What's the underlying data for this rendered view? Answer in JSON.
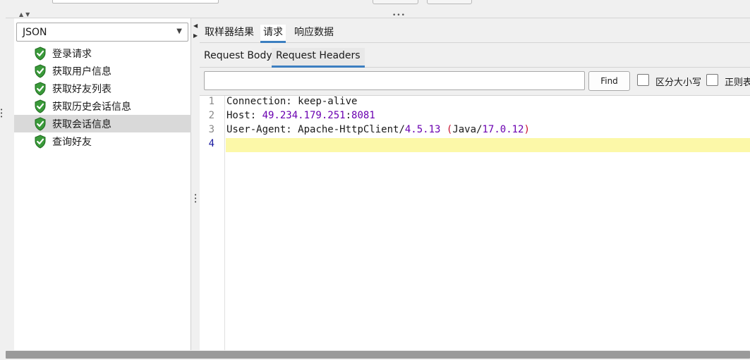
{
  "left": {
    "format_select": "JSON",
    "tree_items": [
      {
        "label": "登录请求"
      },
      {
        "label": "获取用户信息"
      },
      {
        "label": "获取好友列表"
      },
      {
        "label": "获取历史会话信息"
      },
      {
        "label": "获取会话信息",
        "selected": true
      },
      {
        "label": "查询好友"
      }
    ],
    "item_icon": "green-shield-check-icon"
  },
  "tabs": {
    "main": [
      "取样器结果",
      "请求",
      "响应数据"
    ],
    "main_active": "请求",
    "sub": [
      "Request Body",
      "Request Headers"
    ],
    "sub_active": "Request Headers"
  },
  "search": {
    "value": "",
    "find_label": "Find",
    "case_label": "区分大小写",
    "regex_label": "正则表"
  },
  "editor": {
    "line_numbers": [
      "1",
      "2",
      "3",
      "4"
    ],
    "current_line": "4",
    "lines": [
      {
        "key": "Connection: ",
        "value": "keep-alive"
      },
      {
        "key": "Host: ",
        "value": "49.234.179.251:8081"
      },
      {
        "key": "User-Agent: ",
        "value": "Apache-HttpClient/4.5.13 (Java/17.0.12)"
      },
      {
        "key": "",
        "value": ""
      }
    ],
    "colors": {
      "number": "#6a00b0",
      "paren": "#c8102e",
      "current_line_bg": "#fcf8a8"
    }
  }
}
